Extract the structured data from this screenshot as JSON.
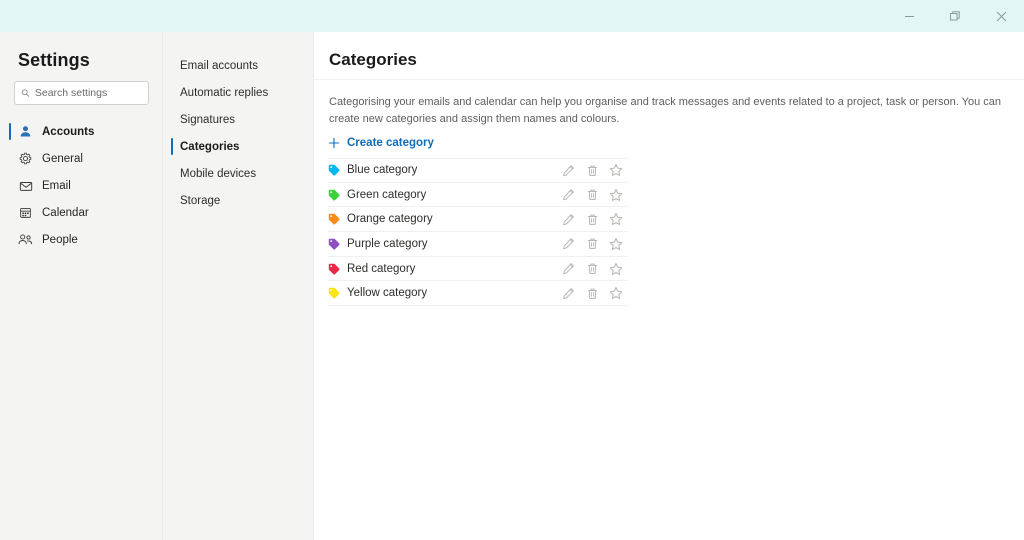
{
  "titlebar": {
    "buttons": [
      {
        "name": "minimize-button",
        "icon": "minimize-icon",
        "label": "Minimize"
      },
      {
        "name": "restore-button",
        "icon": "restore-icon",
        "label": "Restore"
      },
      {
        "name": "close-button",
        "icon": "close-icon",
        "label": "Close"
      }
    ],
    "background": "#e2f6f6"
  },
  "sidebar": {
    "title": "Settings",
    "search": {
      "placeholder": "Search settings",
      "value": "",
      "icon": "search-icon"
    },
    "items": [
      {
        "label": "Accounts",
        "icon": "person-icon",
        "selected": true
      },
      {
        "label": "General",
        "icon": "gear-icon",
        "selected": false
      },
      {
        "label": "Email",
        "icon": "envelope-icon",
        "selected": false
      },
      {
        "label": "Calendar",
        "icon": "calendar-icon",
        "selected": false
      },
      {
        "label": "People",
        "icon": "people-icon",
        "selected": false
      }
    ]
  },
  "midcolumn": {
    "items": [
      {
        "label": "Email accounts",
        "selected": false
      },
      {
        "label": "Automatic replies",
        "selected": false
      },
      {
        "label": "Signatures",
        "selected": false
      },
      {
        "label": "Categories",
        "selected": true
      },
      {
        "label": "Mobile devices",
        "selected": false
      },
      {
        "label": "Storage",
        "selected": false
      }
    ]
  },
  "content": {
    "title": "Categories",
    "description": "Categorising your emails and calendar can help you organise and track messages and events related to a project, task or person. You can create new categories and assign them names and colours.",
    "create_label": "Create category",
    "create_icon": "plus-icon",
    "action_icons": [
      {
        "name": "edit-icon",
        "label": "Edit"
      },
      {
        "name": "delete-icon",
        "label": "Delete"
      },
      {
        "name": "favorite-icon",
        "label": "Add to favourites"
      }
    ],
    "categories": [
      {
        "name": "Blue category",
        "color": "#00b7f0",
        "tag_icon": "tag-icon"
      },
      {
        "name": "Green category",
        "color": "#3bd23b",
        "tag_icon": "tag-icon"
      },
      {
        "name": "Orange category",
        "color": "#fa8c1e",
        "tag_icon": "tag-icon"
      },
      {
        "name": "Purple category",
        "color": "#8e4fc4",
        "tag_icon": "tag-icon"
      },
      {
        "name": "Red category",
        "color": "#e8294a",
        "tag_icon": "tag-icon"
      },
      {
        "name": "Yellow category",
        "color": "#fbe318",
        "tag_icon": "tag-icon"
      }
    ]
  },
  "colors": {
    "accent": "#0f6cbd",
    "panel": "#f4f4f3",
    "titlebar": "#e2f6f6"
  }
}
